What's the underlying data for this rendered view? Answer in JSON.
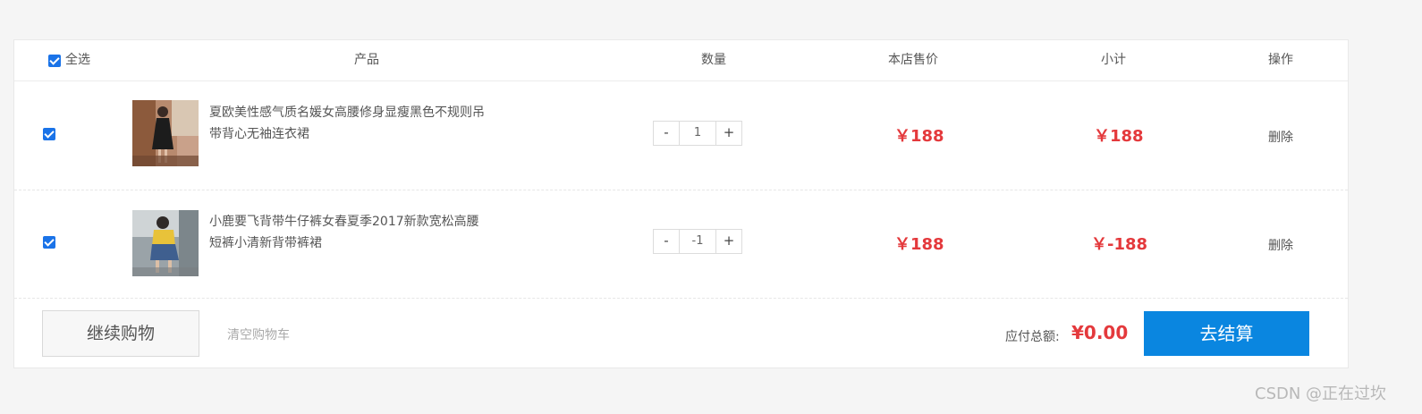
{
  "header": {
    "select_all_label": "全选",
    "col_product": "产品",
    "col_quantity": "数量",
    "col_price": "本店售价",
    "col_subtotal": "小计",
    "col_action": "操作"
  },
  "items": [
    {
      "checked": true,
      "name": "夏欧美性感气质名媛女高腰修身显瘦黑色不规则吊带背心无袖连衣裙",
      "quantity": "1",
      "price": "￥188",
      "subtotal": "￥188",
      "action": "删除",
      "minus": "-",
      "plus": "+"
    },
    {
      "checked": true,
      "name": "小鹿要飞背带牛仔裤女春夏季2017新款宽松高腰短裤小清新背带裤裙",
      "quantity": "-1",
      "price": "￥188",
      "subtotal": "￥-188",
      "action": "删除",
      "minus": "-",
      "plus": "+"
    }
  ],
  "footer": {
    "continue_label": "继续购物",
    "clear_label": "清空购物车",
    "total_label": "应付总额:",
    "total_value": "¥0.00",
    "checkout_label": "去结算"
  },
  "watermark": "CSDN @正在过坎",
  "colors": {
    "price": "#e4393c",
    "checkout_bg": "#0a86e0",
    "checkbox": "#1a73e8"
  }
}
